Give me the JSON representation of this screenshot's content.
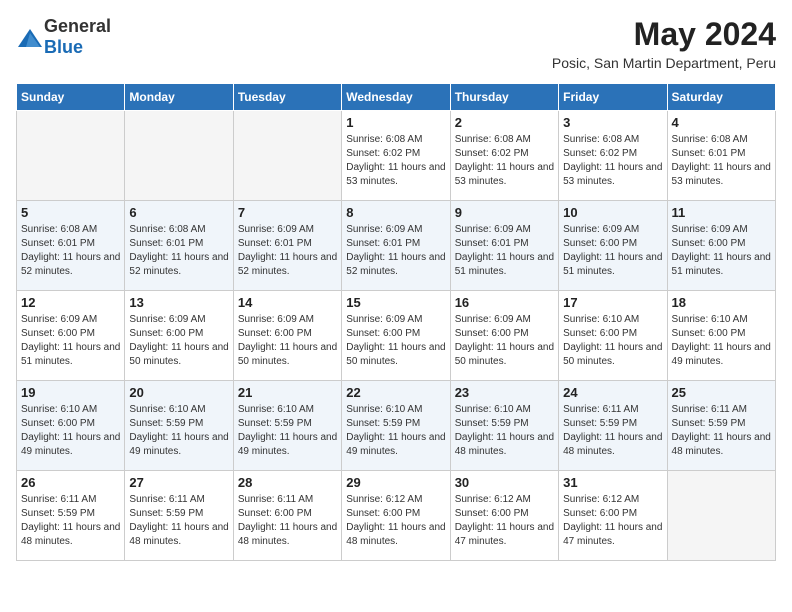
{
  "header": {
    "logo_general": "General",
    "logo_blue": "Blue",
    "month_year": "May 2024",
    "location": "Posic, San Martin Department, Peru"
  },
  "weekdays": [
    "Sunday",
    "Monday",
    "Tuesday",
    "Wednesday",
    "Thursday",
    "Friday",
    "Saturday"
  ],
  "weeks": [
    [
      {
        "day": "",
        "empty": true
      },
      {
        "day": "",
        "empty": true
      },
      {
        "day": "",
        "empty": true
      },
      {
        "day": "1",
        "sunrise": "6:08 AM",
        "sunset": "6:02 PM",
        "daylight": "11 hours and 53 minutes."
      },
      {
        "day": "2",
        "sunrise": "6:08 AM",
        "sunset": "6:02 PM",
        "daylight": "11 hours and 53 minutes."
      },
      {
        "day": "3",
        "sunrise": "6:08 AM",
        "sunset": "6:02 PM",
        "daylight": "11 hours and 53 minutes."
      },
      {
        "day": "4",
        "sunrise": "6:08 AM",
        "sunset": "6:01 PM",
        "daylight": "11 hours and 53 minutes."
      }
    ],
    [
      {
        "day": "5",
        "sunrise": "6:08 AM",
        "sunset": "6:01 PM",
        "daylight": "11 hours and 52 minutes."
      },
      {
        "day": "6",
        "sunrise": "6:08 AM",
        "sunset": "6:01 PM",
        "daylight": "11 hours and 52 minutes."
      },
      {
        "day": "7",
        "sunrise": "6:09 AM",
        "sunset": "6:01 PM",
        "daylight": "11 hours and 52 minutes."
      },
      {
        "day": "8",
        "sunrise": "6:09 AM",
        "sunset": "6:01 PM",
        "daylight": "11 hours and 52 minutes."
      },
      {
        "day": "9",
        "sunrise": "6:09 AM",
        "sunset": "6:01 PM",
        "daylight": "11 hours and 51 minutes."
      },
      {
        "day": "10",
        "sunrise": "6:09 AM",
        "sunset": "6:00 PM",
        "daylight": "11 hours and 51 minutes."
      },
      {
        "day": "11",
        "sunrise": "6:09 AM",
        "sunset": "6:00 PM",
        "daylight": "11 hours and 51 minutes."
      }
    ],
    [
      {
        "day": "12",
        "sunrise": "6:09 AM",
        "sunset": "6:00 PM",
        "daylight": "11 hours and 51 minutes."
      },
      {
        "day": "13",
        "sunrise": "6:09 AM",
        "sunset": "6:00 PM",
        "daylight": "11 hours and 50 minutes."
      },
      {
        "day": "14",
        "sunrise": "6:09 AM",
        "sunset": "6:00 PM",
        "daylight": "11 hours and 50 minutes."
      },
      {
        "day": "15",
        "sunrise": "6:09 AM",
        "sunset": "6:00 PM",
        "daylight": "11 hours and 50 minutes."
      },
      {
        "day": "16",
        "sunrise": "6:09 AM",
        "sunset": "6:00 PM",
        "daylight": "11 hours and 50 minutes."
      },
      {
        "day": "17",
        "sunrise": "6:10 AM",
        "sunset": "6:00 PM",
        "daylight": "11 hours and 50 minutes."
      },
      {
        "day": "18",
        "sunrise": "6:10 AM",
        "sunset": "6:00 PM",
        "daylight": "11 hours and 49 minutes."
      }
    ],
    [
      {
        "day": "19",
        "sunrise": "6:10 AM",
        "sunset": "6:00 PM",
        "daylight": "11 hours and 49 minutes."
      },
      {
        "day": "20",
        "sunrise": "6:10 AM",
        "sunset": "5:59 PM",
        "daylight": "11 hours and 49 minutes."
      },
      {
        "day": "21",
        "sunrise": "6:10 AM",
        "sunset": "5:59 PM",
        "daylight": "11 hours and 49 minutes."
      },
      {
        "day": "22",
        "sunrise": "6:10 AM",
        "sunset": "5:59 PM",
        "daylight": "11 hours and 49 minutes."
      },
      {
        "day": "23",
        "sunrise": "6:10 AM",
        "sunset": "5:59 PM",
        "daylight": "11 hours and 48 minutes."
      },
      {
        "day": "24",
        "sunrise": "6:11 AM",
        "sunset": "5:59 PM",
        "daylight": "11 hours and 48 minutes."
      },
      {
        "day": "25",
        "sunrise": "6:11 AM",
        "sunset": "5:59 PM",
        "daylight": "11 hours and 48 minutes."
      }
    ],
    [
      {
        "day": "26",
        "sunrise": "6:11 AM",
        "sunset": "5:59 PM",
        "daylight": "11 hours and 48 minutes."
      },
      {
        "day": "27",
        "sunrise": "6:11 AM",
        "sunset": "5:59 PM",
        "daylight": "11 hours and 48 minutes."
      },
      {
        "day": "28",
        "sunrise": "6:11 AM",
        "sunset": "6:00 PM",
        "daylight": "11 hours and 48 minutes."
      },
      {
        "day": "29",
        "sunrise": "6:12 AM",
        "sunset": "6:00 PM",
        "daylight": "11 hours and 48 minutes."
      },
      {
        "day": "30",
        "sunrise": "6:12 AM",
        "sunset": "6:00 PM",
        "daylight": "11 hours and 47 minutes."
      },
      {
        "day": "31",
        "sunrise": "6:12 AM",
        "sunset": "6:00 PM",
        "daylight": "11 hours and 47 minutes."
      },
      {
        "day": "",
        "empty": true
      }
    ]
  ]
}
